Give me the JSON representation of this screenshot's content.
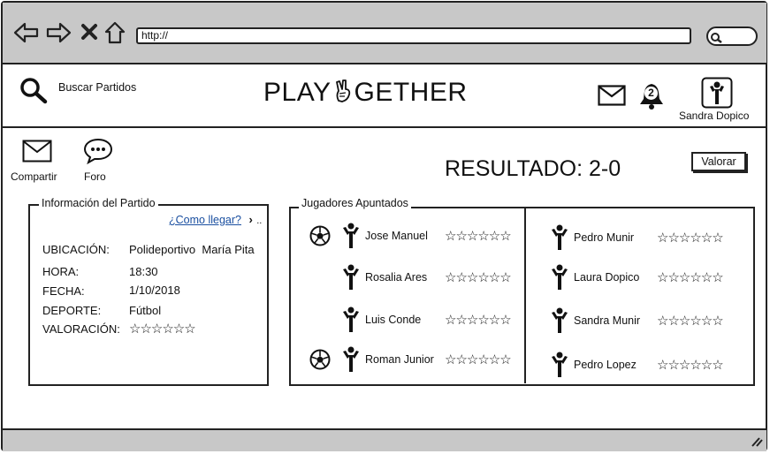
{
  "browser": {
    "url": "http://"
  },
  "header": {
    "search_label": "Buscar Partidos",
    "title_left": "PLAY",
    "title_right": "GETHER",
    "notification_count": "2",
    "user_name": "Sandra Dopico"
  },
  "toolbar": {
    "share_label": "Compartir",
    "forum_label": "Foro"
  },
  "result": {
    "label": "RESULTADO: 2-0",
    "rate_button": "Valorar"
  },
  "match_info": {
    "legend": "Información del Partido",
    "directions_link": "¿Como llegar?",
    "rows": [
      {
        "key": "UBICACIÓN:",
        "value": "Polideportivo  María Pita"
      },
      {
        "key": "HORA:",
        "value": "18:30"
      },
      {
        "key": "FECHA:",
        "value": "1/10/2018"
      },
      {
        "key": "DEPORTE:",
        "value": "Fútbol"
      },
      {
        "key": "VALORACIÓN:",
        "value": ""
      }
    ],
    "rating_stars": "☆☆☆☆☆☆"
  },
  "players": {
    "legend": "Jugadores Apuntados",
    "stars": "☆☆☆☆☆☆",
    "left": [
      {
        "name": "Jose Manuel",
        "scored": true
      },
      {
        "name": "Rosalia Ares",
        "scored": false
      },
      {
        "name": "Luis Conde",
        "scored": false
      },
      {
        "name": "Roman Junior",
        "scored": true
      }
    ],
    "right": [
      {
        "name": "Pedro Munir"
      },
      {
        "name": "Laura Dopico"
      },
      {
        "name": "Sandra Munir"
      },
      {
        "name": "Pedro Lopez"
      }
    ]
  }
}
